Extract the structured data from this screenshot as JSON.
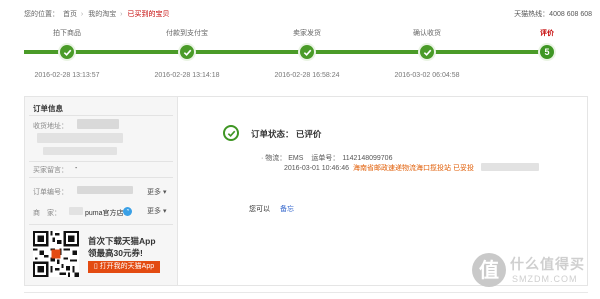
{
  "breadcrumb": {
    "prefix": "您的位置：",
    "items": [
      "首页",
      "我的淘宝",
      "已买到的宝贝"
    ],
    "separator": "›"
  },
  "hotline": "天猫热线：4008 608 608",
  "steps": [
    {
      "label": "拍下商品",
      "time": "2016-02-28 13:13:57",
      "state": "done"
    },
    {
      "label": "付款到支付宝",
      "time": "2016-02-28 13:14:18",
      "state": "done"
    },
    {
      "label": "卖家发货",
      "time": "2016-02-28 16:58:24",
      "state": "done"
    },
    {
      "label": "确认收货",
      "time": "2016-03-02 06:04:58",
      "state": "done"
    },
    {
      "label": "评价",
      "time": "",
      "state": "current",
      "number": "5"
    }
  ],
  "colors": {
    "done": "#4a9b28",
    "accent": "#c40000",
    "link": "#3366cc",
    "place": "#e05a00",
    "app_button": "#e34b12"
  },
  "order_info": {
    "title": "订单信息",
    "address_label": "收货地址：",
    "buyer_msg_label": "买家留言：",
    "buyer_msg_value": "-",
    "order_no_label": "订单编号：",
    "merchant_label": "商　家：",
    "merchant_name": "puma官方店",
    "more_label": "更多"
  },
  "promo": {
    "line1": "首次下载天猫App",
    "line2": "领最高30元券!",
    "button": "打开我的天猫App"
  },
  "status": {
    "label": "订单状态：",
    "value": "已评价",
    "logistics_label": "物流：",
    "carrier": "EMS",
    "tracking_label": "运单号：",
    "tracking_no": "1142148099706",
    "latest_time": "2016-03-01 10:46:46",
    "latest_place": "海南省邮政速递物流海口揽投站 已妥投",
    "you_can": "您可以",
    "memo": "备忘"
  },
  "watermark": {
    "glyph": "值",
    "text": "什么值得买",
    "sub": "SMZDM.COM"
  }
}
